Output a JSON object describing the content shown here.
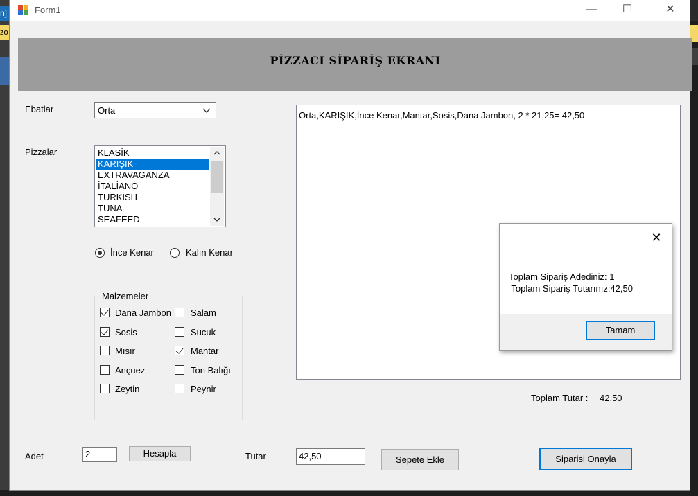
{
  "background": {
    "left_tab": "n]",
    "left_tab2": "zo"
  },
  "window": {
    "title": "Form1",
    "min_glyph": "—",
    "max_glyph": "☐",
    "close_glyph": "✕"
  },
  "header": {
    "title": "PİZZACI SİPARİŞ EKRANI"
  },
  "form": {
    "size_label": "Ebatlar",
    "size_value": "Orta",
    "pizza_label": "Pizzalar",
    "pizzas": [
      "KLASİK",
      "KARIŞIK",
      "EXTRAVAGANZA",
      "İTALİANO",
      "TURKİSH",
      "TUNA",
      "SEAFEED"
    ],
    "selected_pizza_index": 1,
    "crust_thin": "İnce Kenar",
    "crust_thick": "Kalın Kenar",
    "crust_selected": "İnce Kenar",
    "ingredients_title": "Malzemeler",
    "ingredients_left": [
      {
        "label": "Dana Jambon",
        "checked": true
      },
      {
        "label": "Sosis",
        "checked": true
      },
      {
        "label": "Mısır",
        "checked": false
      },
      {
        "label": "Ançuez",
        "checked": false
      },
      {
        "label": "Zeytin",
        "checked": false
      }
    ],
    "ingredients_right": [
      {
        "label": "Salam",
        "checked": false
      },
      {
        "label": "Sucuk",
        "checked": false
      },
      {
        "label": "Mantar",
        "checked": true
      },
      {
        "label": "Ton Balığı",
        "checked": false
      },
      {
        "label": "Peynir",
        "checked": false
      }
    ],
    "quantity_label": "Adet",
    "quantity_value": "2",
    "calc_button": "Hesapla",
    "price_label": "Tutar",
    "price_value": "42,50",
    "add_cart_button": "Sepete Ekle",
    "confirm_button": "Siparisi Onayla",
    "total_label": "Toplam Tutar :",
    "total_value": "42,50"
  },
  "order_output": {
    "lines": [
      "Orta,KARIŞIK,İnce Kenar,Mantar,Sosis,Dana Jambon, 2 * 21,25= 42,50"
    ]
  },
  "message_box": {
    "line1": "Toplam Sipariş Adediniz: 1",
    "line2": " Toplam Sipariş Tutarınız:42,50",
    "ok_button": "Tamam",
    "close_glyph": "✕"
  }
}
